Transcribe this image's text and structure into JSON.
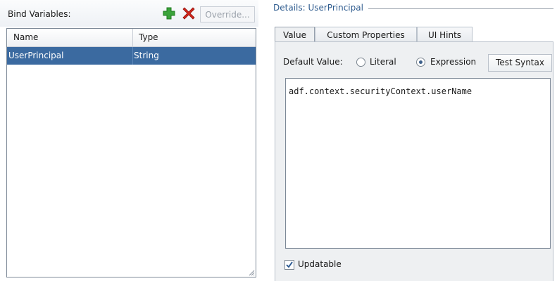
{
  "bind_variables": {
    "title": "Bind Variables:",
    "override_label": "Override...",
    "add_icon": "plus-icon",
    "delete_icon": "x-icon",
    "columns": [
      "Name",
      "Type"
    ],
    "rows": [
      {
        "name": "UserPrincipal",
        "type": "String"
      }
    ]
  },
  "details": {
    "title": "Details: UserPrincipal",
    "tabs": [
      {
        "label": "Value",
        "active": true
      },
      {
        "label": "Custom Properties",
        "active": false
      },
      {
        "label": "UI Hints",
        "active": false
      }
    ],
    "default_value_label": "Default Value:",
    "radio_literal": "Literal",
    "radio_expression": "Expression",
    "selected": "Expression",
    "test_syntax_label": "Test Syntax",
    "expression_value": "adf.context.securityContext.userName",
    "updatable_label": "Updatable",
    "updatable_checked": true
  },
  "colors": {
    "selection": "#3b6aa0",
    "title_blue": "#2f5c8f",
    "add_green": "#3aa33a",
    "delete_red": "#d2261c"
  }
}
